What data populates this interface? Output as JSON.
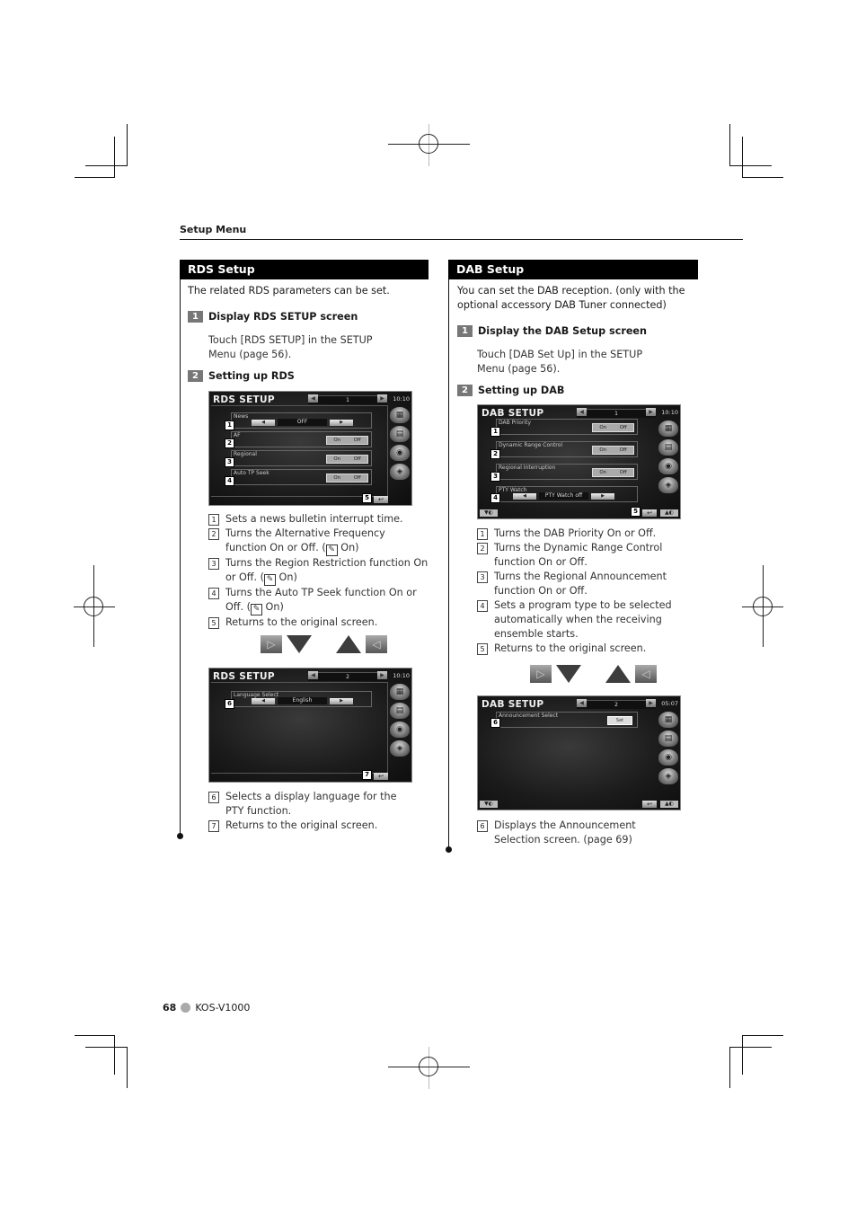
{
  "header": {
    "section": "Setup Menu"
  },
  "rds": {
    "title": "RDS Setup",
    "intro": "The related RDS parameters can be set.",
    "step1": {
      "num": "1",
      "title": "Display RDS SETUP screen",
      "body": "Touch [RDS SETUP] in the SETUP Menu (page 56)."
    },
    "step2": {
      "num": "2",
      "title": "Setting up RDS"
    },
    "screen1": {
      "title": "RDS SETUP",
      "page": "1",
      "time": "10:10",
      "rows": [
        {
          "badge": "1",
          "label": "News",
          "type": "selector",
          "value": "OFF"
        },
        {
          "badge": "2",
          "label": "AF",
          "type": "onoff",
          "on": "On",
          "off": "Off"
        },
        {
          "badge": "3",
          "label": "Regional",
          "type": "onoff",
          "on": "On",
          "off": "Off"
        },
        {
          "badge": "4",
          "label": "Auto TP Seek",
          "type": "onoff",
          "on": "On",
          "off": "Off"
        }
      ],
      "return_badge": "5"
    },
    "notes1": [
      {
        "num": "1",
        "text": "Sets a news bulletin interrupt time."
      },
      {
        "num": "2",
        "text": "Turns the Alternative Frequency function On or Off. (",
        "suffix": " On)"
      },
      {
        "num": "3",
        "text": "Turns the Region Restriction function On or Off. (",
        "suffix": " On)"
      },
      {
        "num": "4",
        "text": "Turns the Auto TP Seek function On or Off. (",
        "suffix": " On)"
      },
      {
        "num": "5",
        "text": "Returns to the original screen."
      }
    ],
    "screen2": {
      "title": "RDS SETUP",
      "page": "2",
      "time": "10:10",
      "row": {
        "badge": "6",
        "label": "Language Select",
        "value": "English"
      },
      "return_badge": "7"
    },
    "notes2": [
      {
        "num": "6",
        "text": "Selects a display language for the PTY function."
      },
      {
        "num": "7",
        "text": "Returns to the original screen."
      }
    ]
  },
  "dab": {
    "title": "DAB Setup",
    "intro": "You can set the DAB reception. (only with the optional accessory DAB Tuner connected)",
    "step1": {
      "num": "1",
      "title": "Display the DAB Setup screen",
      "body": "Touch [DAB Set Up] in the SETUP Menu (page 56)."
    },
    "step2": {
      "num": "2",
      "title": "Setting up DAB"
    },
    "screen1": {
      "title": "DAB SETUP",
      "page": "1",
      "time": "10:10",
      "rows": [
        {
          "badge": "1",
          "label": "DAB Priority",
          "type": "onoff",
          "on": "On",
          "off": "Off"
        },
        {
          "badge": "2",
          "label": "Dynamic Range Control",
          "type": "onoff",
          "on": "On",
          "off": "Off"
        },
        {
          "badge": "3",
          "label": "Regional Interruption",
          "type": "onoff",
          "on": "On",
          "off": "Off"
        },
        {
          "badge": "4",
          "label": "PTY Watch",
          "type": "selector",
          "value": "PTY Watch off"
        }
      ],
      "return_badge": "5"
    },
    "notes1": [
      {
        "num": "1",
        "text": "Turns the DAB Priority On or Off."
      },
      {
        "num": "2",
        "text": "Turns the Dynamic Range Control function On or Off."
      },
      {
        "num": "3",
        "text": "Turns the Regional Announcement function On or Off."
      },
      {
        "num": "4",
        "text": "Sets a program type to be selected automatically when the receiving ensemble starts."
      },
      {
        "num": "5",
        "text": "Returns to the original screen."
      }
    ],
    "screen2": {
      "title": "DAB SETUP",
      "page": "2",
      "time": "05:07",
      "row": {
        "badge": "6",
        "label": "Announcement Select",
        "button": "Set"
      }
    },
    "notes2": [
      {
        "num": "6",
        "text": "Displays the Announcement Selection screen. (page 69)"
      }
    ]
  },
  "icons": {
    "pen": "✎",
    "return": "↩",
    "prev": "◀",
    "next": "▶"
  },
  "footer": {
    "page": "68",
    "model": "KOS-V1000"
  }
}
